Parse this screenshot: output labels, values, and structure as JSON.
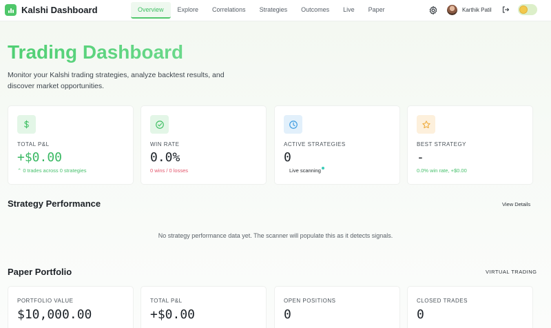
{
  "app": {
    "title": "Kalshi Dashboard"
  },
  "nav": {
    "tabs": [
      {
        "label": "Overview",
        "active": true
      },
      {
        "label": "Explore"
      },
      {
        "label": "Correlations"
      },
      {
        "label": "Strategies"
      },
      {
        "label": "Outcomes"
      },
      {
        "label": "Live"
      },
      {
        "label": "Paper"
      }
    ],
    "user_name": "Karthik Patil"
  },
  "hero": {
    "title": "Trading Dashboard",
    "subtitle": "Monitor your Kalshi trading strategies, analyze backtest results, and discover market opportunities."
  },
  "stats": [
    {
      "icon": "dollar-icon",
      "label": "TOTAL P&L",
      "value": "+$0.00",
      "note": "⌃ 0 trades across 0 strategies",
      "tint": "#e3f6e7",
      "color": "#3fbf63"
    },
    {
      "icon": "check-circle-icon",
      "label": "WIN RATE",
      "value": "0.0%",
      "note": "0 wins / 0 losses",
      "tint": "#e3f6e7",
      "color": "#3fbf63"
    },
    {
      "icon": "clock-icon",
      "label": "ACTIVE STRATEGIES",
      "value": "0",
      "note": "Live scanning",
      "tint": "#e2f0fb",
      "color": "#3b9be0"
    },
    {
      "icon": "star-icon",
      "label": "BEST STRATEGY",
      "value": "-",
      "note": "0.0% win rate, +$0.00",
      "tint": "#fdf0dc",
      "color": "#eeaa3a"
    }
  ],
  "strategy_performance": {
    "title": "Strategy Performance",
    "link": "View Details",
    "empty_message": "No strategy performance data yet. The scanner will populate this as it detects signals."
  },
  "paper_portfolio": {
    "title": "Paper Portfolio",
    "badge": "VIRTUAL TRADING",
    "cards": [
      {
        "label": "PORTFOLIO VALUE",
        "value": "$10,000.00"
      },
      {
        "label": "TOTAL P&L",
        "value": "+$0.00"
      },
      {
        "label": "OPEN POSITIONS",
        "value": "0"
      },
      {
        "label": "CLOSED TRADES",
        "value": "0"
      }
    ]
  },
  "colors": {
    "accent": "#4fc76a",
    "negative": "#e3556b"
  }
}
